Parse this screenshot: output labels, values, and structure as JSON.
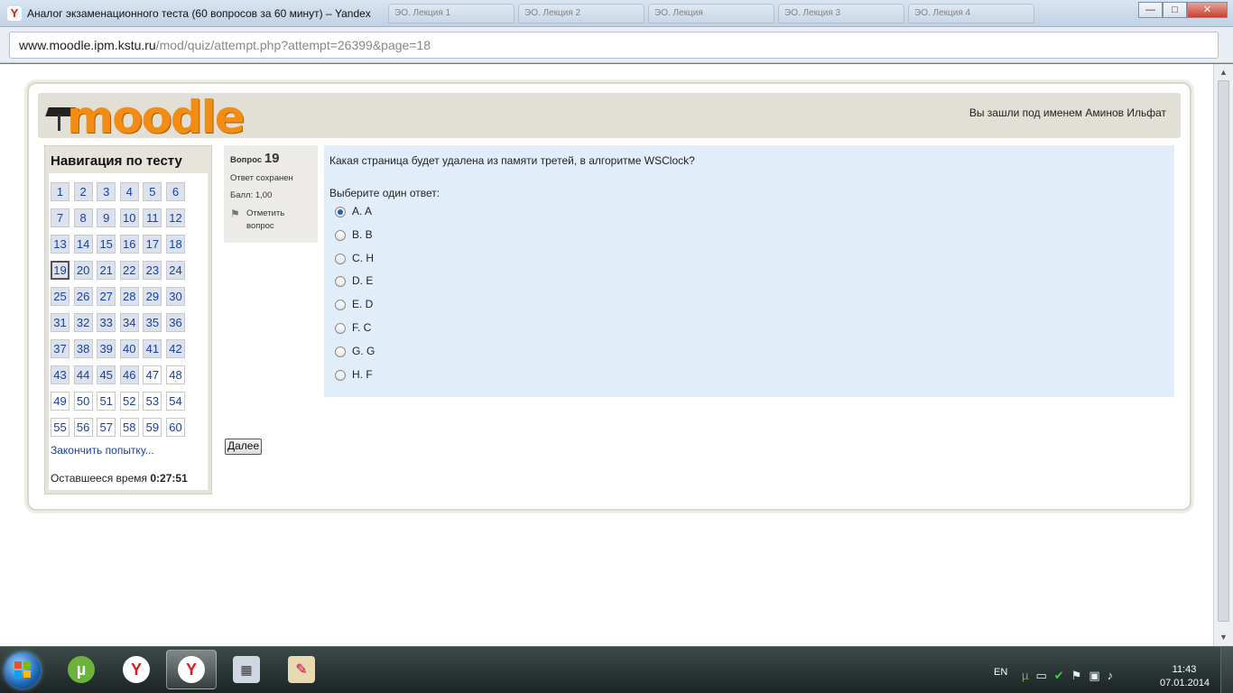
{
  "window": {
    "title": "Аналог экзаменационного теста (60 вопросов за 60 минут) – Yandex",
    "tabs": [
      "ЭО. Лекция 1",
      "ЭО. Лекция 2",
      "ЭО. Лекция",
      "ЭО. Лекция 3",
      "ЭО. Лекция 4"
    ],
    "buttons": {
      "minimize": "—",
      "maximize": "□",
      "close": "✕"
    }
  },
  "address": {
    "host": "www.moodle.ipm.kstu.ru",
    "path": "/mod/quiz/attempt.php?attempt=26399&page=18"
  },
  "header": {
    "logo_text": "moodle",
    "login_info": "Вы зашли под именем Аминов Ильфат"
  },
  "nav": {
    "title": "Навигация по тесту",
    "questions": [
      {
        "n": "1",
        "s": "a"
      },
      {
        "n": "2",
        "s": "a"
      },
      {
        "n": "3",
        "s": "a"
      },
      {
        "n": "4",
        "s": "a"
      },
      {
        "n": "5",
        "s": "a"
      },
      {
        "n": "6",
        "s": "a"
      },
      {
        "n": "7",
        "s": "a"
      },
      {
        "n": "8",
        "s": "a"
      },
      {
        "n": "9",
        "s": "a"
      },
      {
        "n": "10",
        "s": "a"
      },
      {
        "n": "11",
        "s": "a"
      },
      {
        "n": "12",
        "s": "a"
      },
      {
        "n": "13",
        "s": "a"
      },
      {
        "n": "14",
        "s": "a"
      },
      {
        "n": "15",
        "s": "a"
      },
      {
        "n": "16",
        "s": "a"
      },
      {
        "n": "17",
        "s": "a"
      },
      {
        "n": "18",
        "s": "a"
      },
      {
        "n": "19",
        "s": "current"
      },
      {
        "n": "20",
        "s": "a"
      },
      {
        "n": "21",
        "s": "a"
      },
      {
        "n": "22",
        "s": "a"
      },
      {
        "n": "23",
        "s": "a"
      },
      {
        "n": "24",
        "s": "a"
      },
      {
        "n": "25",
        "s": "a"
      },
      {
        "n": "26",
        "s": "a"
      },
      {
        "n": "27",
        "s": "a"
      },
      {
        "n": "28",
        "s": "a"
      },
      {
        "n": "29",
        "s": "a"
      },
      {
        "n": "30",
        "s": "a"
      },
      {
        "n": "31",
        "s": "a"
      },
      {
        "n": "32",
        "s": "a"
      },
      {
        "n": "33",
        "s": "a"
      },
      {
        "n": "34",
        "s": "a"
      },
      {
        "n": "35",
        "s": "a"
      },
      {
        "n": "36",
        "s": "a"
      },
      {
        "n": "37",
        "s": "a"
      },
      {
        "n": "38",
        "s": "a"
      },
      {
        "n": "39",
        "s": "a"
      },
      {
        "n": "40",
        "s": "a"
      },
      {
        "n": "41",
        "s": "a"
      },
      {
        "n": "42",
        "s": "a"
      },
      {
        "n": "43",
        "s": "a"
      },
      {
        "n": "44",
        "s": "a"
      },
      {
        "n": "45",
        "s": "a"
      },
      {
        "n": "46",
        "s": "a"
      },
      {
        "n": "47",
        "s": "u"
      },
      {
        "n": "48",
        "s": "u"
      },
      {
        "n": "49",
        "s": "u"
      },
      {
        "n": "50",
        "s": "u"
      },
      {
        "n": "51",
        "s": "u"
      },
      {
        "n": "52",
        "s": "u"
      },
      {
        "n": "53",
        "s": "u"
      },
      {
        "n": "54",
        "s": "u"
      },
      {
        "n": "55",
        "s": "u"
      },
      {
        "n": "56",
        "s": "u"
      },
      {
        "n": "57",
        "s": "u"
      },
      {
        "n": "58",
        "s": "u"
      },
      {
        "n": "59",
        "s": "u"
      },
      {
        "n": "60",
        "s": "u"
      }
    ],
    "finish_link": "Закончить попытку...",
    "timer_label": "Оставшееся время",
    "timer_value": "0:27:51"
  },
  "qinfo": {
    "label": "Вопрос",
    "number": "19",
    "status": "Ответ сохранен",
    "score": "Балл: 1,00",
    "flag": "Отметить вопрос"
  },
  "question": {
    "text": "Какая страница будет удалена из памяти третей, в алгоритме WSClock?",
    "prompt": "Выберите один ответ:",
    "options": [
      {
        "label": "A. A",
        "selected": true
      },
      {
        "label": "B. B",
        "selected": false
      },
      {
        "label": "C. H",
        "selected": false
      },
      {
        "label": "D. E",
        "selected": false
      },
      {
        "label": "E. D",
        "selected": false
      },
      {
        "label": "F. C",
        "selected": false
      },
      {
        "label": "G. G",
        "selected": false
      },
      {
        "label": "H. F",
        "selected": false
      }
    ]
  },
  "next_button": "Далее",
  "taskbar": {
    "lang": "EN",
    "time": "11:43",
    "date": "07.01.2014"
  },
  "colors": {
    "accent": "#f28c12",
    "link": "#1a3fa0",
    "question_bg": "#e1eef9"
  }
}
